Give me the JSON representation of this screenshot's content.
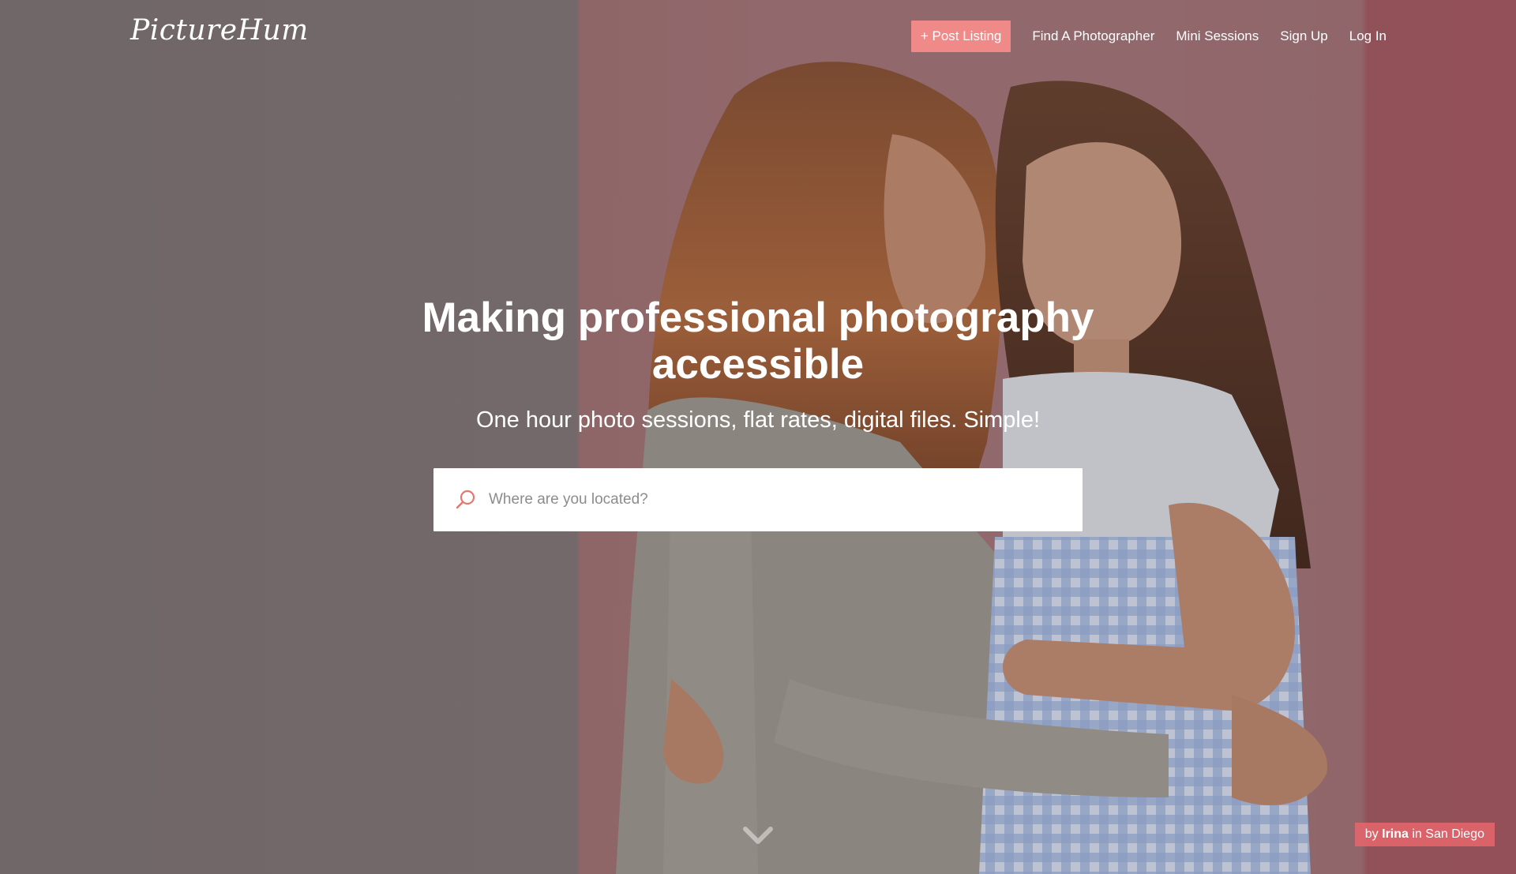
{
  "site": {
    "logo": "PictureHum"
  },
  "nav": {
    "post_listing": "+ Post Listing",
    "find_photographer": "Find A Photographer",
    "mini_sessions": "Mini Sessions",
    "sign_up": "Sign Up",
    "log_in": "Log In"
  },
  "hero": {
    "headline": "Making professional photography accessible",
    "subheadline": "One hour photo sessions, flat rates, digital files. Simple!",
    "search_placeholder": "Where are you located?",
    "search_icon": "search-icon",
    "scroll_icon": "chevron-down-icon"
  },
  "credit": {
    "prefix": "by",
    "photographer": "Irina",
    "middle": "in",
    "location": "San Diego"
  },
  "colors": {
    "accent": "#f08a88",
    "credit_bg": "#e6666c"
  }
}
